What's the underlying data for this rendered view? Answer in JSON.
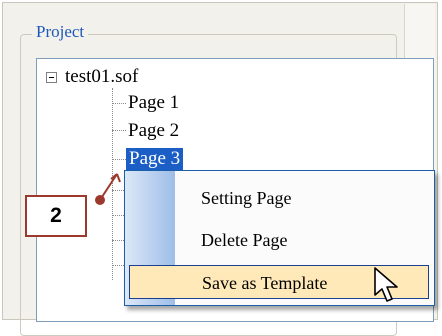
{
  "group": {
    "title": "Project"
  },
  "tree": {
    "root_label": "test01.sof",
    "pages": [
      "Page 1",
      "Page 2",
      "Page 3"
    ]
  },
  "context_menu": {
    "items": [
      "Setting Page",
      "Delete Page",
      "Save as Template"
    ],
    "highlighted_index": 2
  },
  "callout": {
    "number": "2"
  },
  "colors": {
    "selection": "#1b5fc6",
    "menu_highlight": "#ffe9b8",
    "callout_border": "#9b3a2c",
    "group_title": "#1f57b8"
  }
}
